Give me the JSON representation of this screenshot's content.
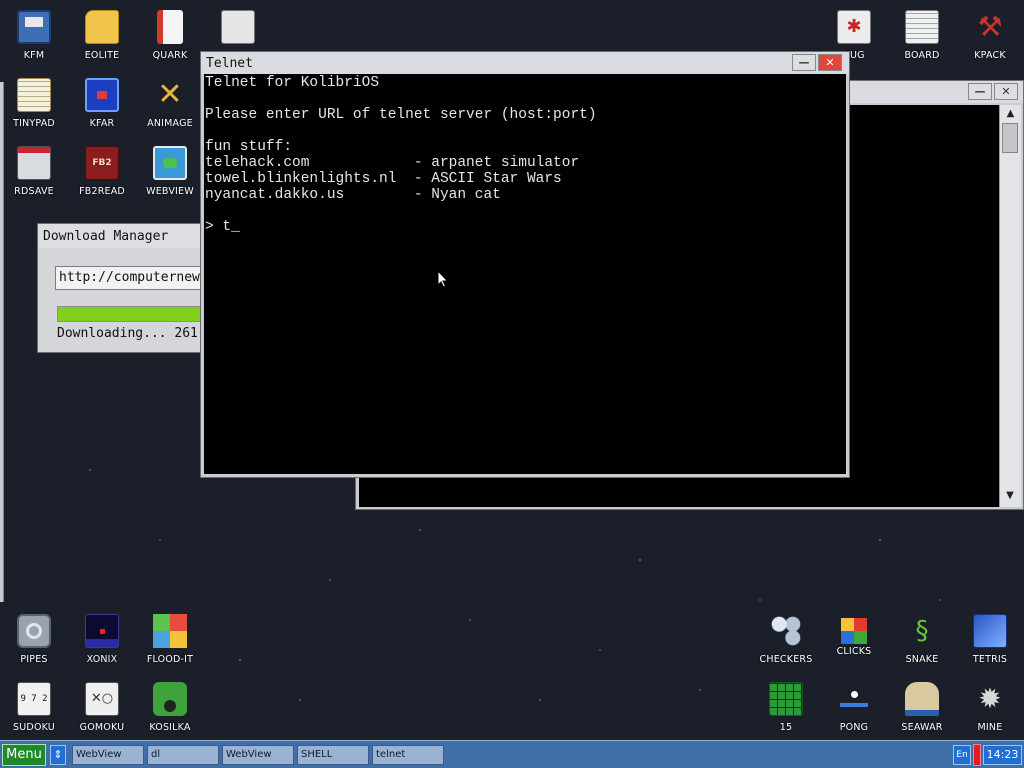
{
  "desktop": {
    "icons_top_left": [
      {
        "label": "KFM",
        "icon": "floppy-disk-icon"
      },
      {
        "label": "EOLITE",
        "icon": "folder-icon"
      },
      {
        "label": "QUARK",
        "icon": "notebook-icon"
      },
      {
        "label": "TINYPAD",
        "icon": "notepad-icon"
      },
      {
        "label": "KFAR",
        "icon": "kfar-icon"
      },
      {
        "label": "ANIMAGE",
        "icon": "paint-tools-icon"
      },
      {
        "label": "RDSAVE",
        "icon": "rdsave-icon"
      },
      {
        "label": "FB2READ",
        "icon": "book-icon"
      },
      {
        "label": "WEBVIEW",
        "icon": "globe-icon"
      },
      {
        "label": "",
        "icon": "calculator-icon"
      }
    ],
    "icons_top_right": [
      {
        "label": "BUG",
        "icon": "bug-icon"
      },
      {
        "label": "BOARD",
        "icon": "board-icon"
      },
      {
        "label": "KPACK",
        "icon": "hammer-icon"
      }
    ],
    "icons_bottom_left": [
      {
        "label": "PIPES",
        "icon": "pipes-icon"
      },
      {
        "label": "XONIX",
        "icon": "xonix-icon"
      },
      {
        "label": "FLOOD-IT",
        "icon": "flood-it-icon"
      },
      {
        "label": "SUDOKU",
        "icon": "sudoku-icon"
      },
      {
        "label": "GOMOKU",
        "icon": "gomoku-icon"
      },
      {
        "label": "KOSILKA",
        "icon": "lawnmower-icon"
      }
    ],
    "icons_bottom_right": [
      {
        "label": "CHECKERS",
        "icon": "checkers-icon"
      },
      {
        "label": "CLICKS",
        "icon": "clicks-icon"
      },
      {
        "label": "SNAKE",
        "icon": "snake-icon"
      },
      {
        "label": "TETRIS",
        "icon": "tetris-icon"
      },
      {
        "label": "15",
        "icon": "fifteen-puzzle-icon"
      },
      {
        "label": "PONG",
        "icon": "pong-icon"
      },
      {
        "label": "SEAWAR",
        "icon": "seawar-icon"
      },
      {
        "label": "MINE",
        "icon": "mine-icon"
      }
    ],
    "sudoku_digits": "9 7 2"
  },
  "download_manager": {
    "title": "Download Manager",
    "url_value": "http://computernew",
    "progress_fraction": 0.93,
    "status_text": "Downloading... 261"
  },
  "telnet": {
    "title": "Telnet",
    "minimize_glyph": "—",
    "close_glyph": "✕",
    "lines": [
      "Telnet for KolibriOS",
      "",
      "Please enter URL of telnet server (host:port)",
      "",
      "fun stuff:",
      "telehack.com            - arpanet simulator",
      "towel.blinkenlights.nl  - ASCII Star Wars",
      "nyancat.dakko.us        - Nyan cat",
      "",
      "> t_"
    ]
  },
  "background_window": {
    "minimize_glyph": "—",
    "close_glyph": "✕",
    "scroll_up_glyph": "▲",
    "scroll_down_glyph": "▼"
  },
  "taskbar": {
    "menu_label": "Menu",
    "switch_glyph": "⇕",
    "tasks": [
      "WebView",
      "dl",
      "WebView",
      "SHELL",
      "telnet"
    ],
    "language": "En",
    "clock": "14:23"
  },
  "colors": {
    "menu_button": "#1f8a2a",
    "taskbar": "#3f6fa6",
    "progress_fill": "#7fd11b",
    "clock_bg": "#1f6fd6",
    "close_button": "#e0473a"
  }
}
